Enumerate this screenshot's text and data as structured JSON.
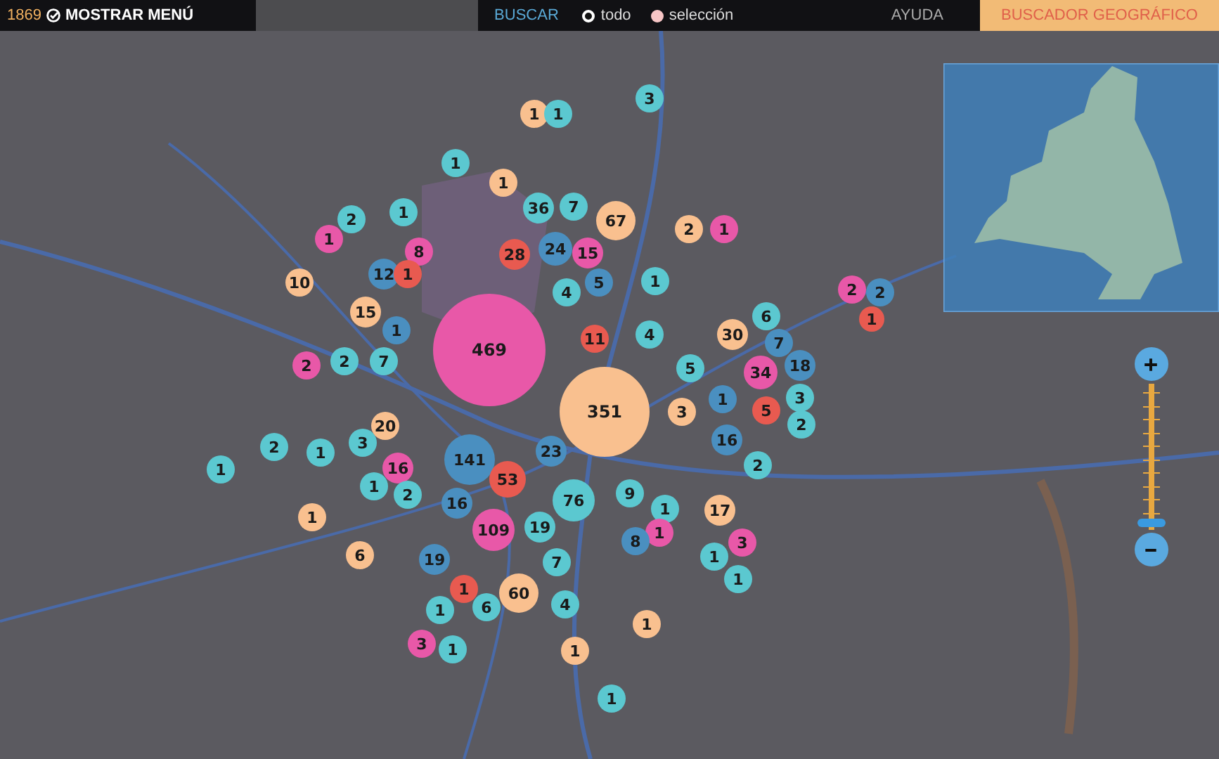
{
  "top_bar": {
    "count": "1869",
    "menu_button": "MOSTRAR MENÚ",
    "search_button": "BUSCAR",
    "filters": [
      {
        "label": "todo",
        "selected": true
      },
      {
        "label": "selección",
        "selected": false
      }
    ],
    "help": "AYUDA",
    "tabs": [
      {
        "label": "BUSCADOR GEOGRÁFICO",
        "selected": true
      }
    ]
  },
  "map": {
    "markers": [
      {
        "count": "1",
        "color": "#f9c08f"
      },
      {
        "count": "1",
        "color": "#5bc8d0"
      },
      {
        "count": "3",
        "color": "#5bc8d0"
      },
      {
        "count": "1",
        "color": "#5bc8d0"
      },
      {
        "count": "1",
        "color": "#f9c08f"
      },
      {
        "count": "2",
        "color": "#5bc8d0"
      },
      {
        "count": "1",
        "color": "#5bc8d0"
      },
      {
        "count": "1",
        "color": "#e858a8"
      },
      {
        "count": "36",
        "color": "#5bc8d0"
      },
      {
        "count": "7",
        "color": "#5bc8d0"
      },
      {
        "count": "67",
        "color": "#f9c08f"
      },
      {
        "count": "2",
        "color": "#f9c08f"
      },
      {
        "count": "1",
        "color": "#e858a8"
      },
      {
        "count": "8",
        "color": "#e858a8"
      },
      {
        "count": "28",
        "color": "#e85a50"
      },
      {
        "count": "24",
        "color": "#4a8fc0"
      },
      {
        "count": "15",
        "color": "#e858a8"
      },
      {
        "count": "12",
        "color": "#4a8fc0"
      },
      {
        "count": "1",
        "color": "#e85a50"
      },
      {
        "count": "10",
        "color": "#f9c08f"
      },
      {
        "count": "5",
        "color": "#4a8fc0"
      },
      {
        "count": "1",
        "color": "#5bc8d0"
      },
      {
        "count": "4",
        "color": "#5bc8d0"
      },
      {
        "count": "15",
        "color": "#f9c08f"
      },
      {
        "count": "1",
        "color": "#4a8fc0"
      },
      {
        "count": "469",
        "color": "#e858a8"
      },
      {
        "count": "11",
        "color": "#e85a50"
      },
      {
        "count": "4",
        "color": "#5bc8d0"
      },
      {
        "count": "2",
        "color": "#e858a8"
      },
      {
        "count": "2",
        "color": "#5bc8d0"
      },
      {
        "count": "7",
        "color": "#5bc8d0"
      },
      {
        "count": "30",
        "color": "#f9c08f"
      },
      {
        "count": "6",
        "color": "#5bc8d0"
      },
      {
        "count": "7",
        "color": "#4a8fc0"
      },
      {
        "count": "2",
        "color": "#e858a8"
      },
      {
        "count": "2",
        "color": "#4a8fc0"
      },
      {
        "count": "1",
        "color": "#e85a50"
      },
      {
        "count": "5",
        "color": "#5bc8d0"
      },
      {
        "count": "34",
        "color": "#e858a8"
      },
      {
        "count": "18",
        "color": "#4a8fc0"
      },
      {
        "count": "351",
        "color": "#f9c08f"
      },
      {
        "count": "3",
        "color": "#f9c08f"
      },
      {
        "count": "1",
        "color": "#4a8fc0"
      },
      {
        "count": "5",
        "color": "#e85a50"
      },
      {
        "count": "3",
        "color": "#5bc8d0"
      },
      {
        "count": "2",
        "color": "#5bc8d0"
      },
      {
        "count": "1",
        "color": "#5bc8d0"
      },
      {
        "count": "2",
        "color": "#5bc8d0"
      },
      {
        "count": "1",
        "color": "#5bc8d0"
      },
      {
        "count": "3",
        "color": "#5bc8d0"
      },
      {
        "count": "20",
        "color": "#f9c08f"
      },
      {
        "count": "16",
        "color": "#e858a8"
      },
      {
        "count": "141",
        "color": "#4a8fc0"
      },
      {
        "count": "23",
        "color": "#4a8fc0"
      },
      {
        "count": "16",
        "color": "#4a8fc0"
      },
      {
        "count": "2",
        "color": "#5bc8d0"
      },
      {
        "count": "1",
        "color": "#5bc8d0"
      },
      {
        "count": "2",
        "color": "#5bc8d0"
      },
      {
        "count": "53",
        "color": "#e85a50"
      },
      {
        "count": "16",
        "color": "#4a8fc0"
      },
      {
        "count": "76",
        "color": "#5bc8d0"
      },
      {
        "count": "9",
        "color": "#5bc8d0"
      },
      {
        "count": "1",
        "color": "#5bc8d0"
      },
      {
        "count": "17",
        "color": "#f9c08f"
      },
      {
        "count": "1",
        "color": "#f9c08f"
      },
      {
        "count": "109",
        "color": "#e858a8"
      },
      {
        "count": "19",
        "color": "#5bc8d0"
      },
      {
        "count": "1",
        "color": "#e858a8"
      },
      {
        "count": "8",
        "color": "#4a8fc0"
      },
      {
        "count": "3",
        "color": "#e858a8"
      },
      {
        "count": "1",
        "color": "#5bc8d0"
      },
      {
        "count": "1",
        "color": "#5bc8d0"
      },
      {
        "count": "6",
        "color": "#f9c08f"
      },
      {
        "count": "19",
        "color": "#4a8fc0"
      },
      {
        "count": "7",
        "color": "#5bc8d0"
      },
      {
        "count": "1",
        "color": "#e85a50"
      },
      {
        "count": "60",
        "color": "#f9c08f"
      },
      {
        "count": "1",
        "color": "#5bc8d0"
      },
      {
        "count": "6",
        "color": "#5bc8d0"
      },
      {
        "count": "4",
        "color": "#5bc8d0"
      },
      {
        "count": "1",
        "color": "#f9c08f"
      },
      {
        "count": "3",
        "color": "#e858a8"
      },
      {
        "count": "1",
        "color": "#5bc8d0"
      },
      {
        "count": "1",
        "color": "#f9c08f"
      },
      {
        "count": "1",
        "color": "#5bc8d0"
      }
    ],
    "zoom": {
      "level": 0.02
    }
  }
}
